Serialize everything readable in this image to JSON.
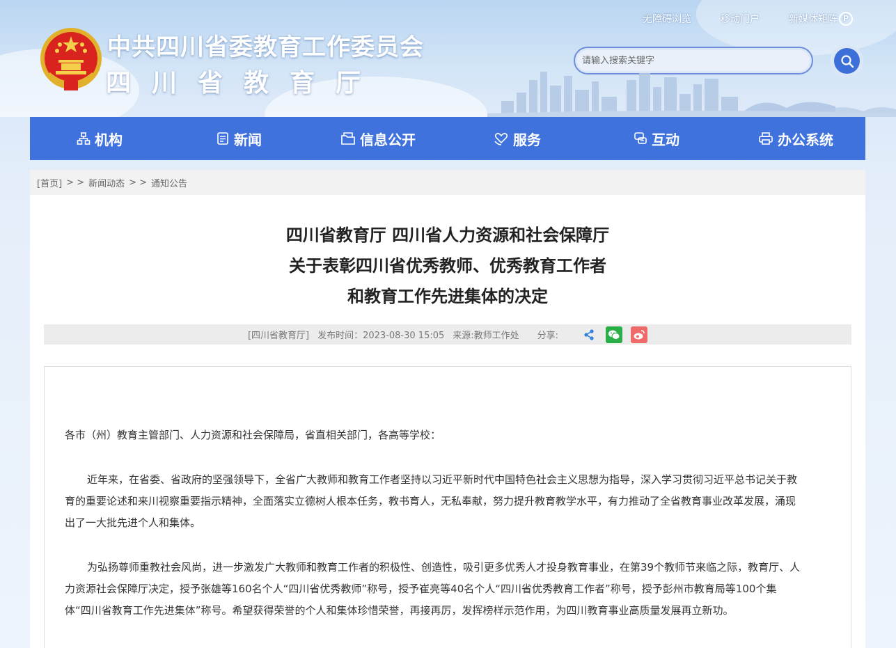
{
  "header": {
    "title": "中共四川省委教育工作委员会",
    "subtitle": "四川省教育厅",
    "toplinks": {
      "accessible": "无障碍浏览",
      "mobile": "移动门户",
      "new_media": "新媒体矩阵"
    },
    "search": {
      "placeholder": "请输入搜索关键字"
    }
  },
  "nav": {
    "items": [
      {
        "label": "机构",
        "icon": "org-icon"
      },
      {
        "label": "新闻",
        "icon": "news-icon"
      },
      {
        "label": "信息公开",
        "icon": "folder-icon"
      },
      {
        "label": "服务",
        "icon": "heart-hand-icon"
      },
      {
        "label": "互动",
        "icon": "chat-icon"
      },
      {
        "label": "办公系统",
        "icon": "printer-icon"
      }
    ]
  },
  "breadcrumb": {
    "home": "[首页]",
    "separator": "> >",
    "level1": "新闻动态",
    "level2": "通知公告"
  },
  "article": {
    "title_lines": [
      "四川省教育厅 四川省人力资源和社会保障厅",
      "关于表彰四川省优秀教师、优秀教育工作者",
      "和教育工作先进集体的决定"
    ],
    "meta": {
      "publisher": "[四川省教育厅]",
      "publish_time": "发布时间：2023-08-30 15:05",
      "source": "来源:教师工作处",
      "share_label": "分享:"
    },
    "salutation": "各市（州）教育主管部门、人力资源和社会保障局，省直相关部门，各高等学校：",
    "paragraphs": [
      "近年来，在省委、省政府的坚强领导下，全省广大教师和教育工作者坚持以习近平新时代中国特色社会主义思想为指导，深入学习贯彻习近平总书记关于教育的重要论述和来川视察重要指示精神，全面落实立德树人根本任务，教书育人，无私奉献，努力提升教育教学水平，有力推动了全省教育事业改革发展，涌现出了一大批先进个人和集体。",
      "为弘扬尊师重教社会风尚，进一步激发广大教师和教育工作者的积极性、创造性，吸引更多优秀人才投身教育事业，在第39个教师节来临之际，教育厅、人力资源社会保障厅决定，授予张雄等160名个人“四川省优秀教师”称号，授予崔亮等40名个人“四川省优秀教育工作者”称号，授予彭州市教育局等100个集体“四川省教育工作先进集体”称号。希望获得荣誉的个人和集体珍惜荣誉，再接再厉，发挥榜样示范作用，为四川教育事业高质量发展再立新功。"
    ]
  },
  "colors": {
    "nav_bg": "#3f72dd",
    "accent": "#3d6fd8",
    "wechat": "#2aae47",
    "weibo": "#f16a6a",
    "share": "#2f7fdc"
  }
}
